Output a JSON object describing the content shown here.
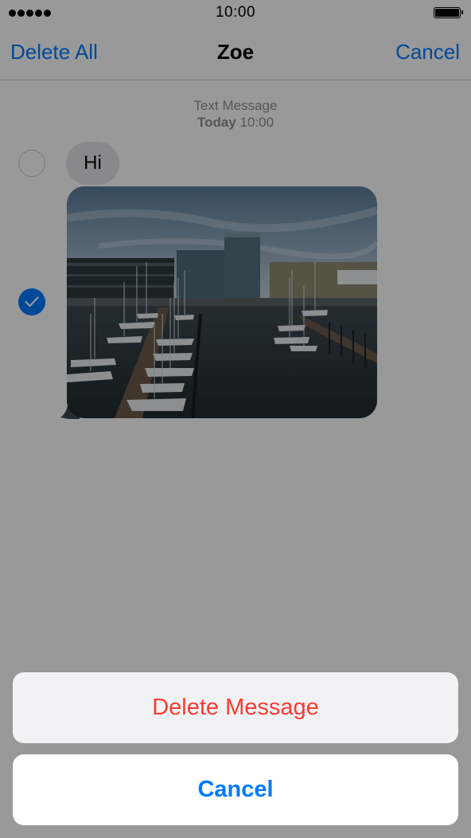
{
  "status_bar": {
    "time": "10:00",
    "signal_icon": "signal-dots-icon",
    "battery_icon": "battery-icon"
  },
  "nav": {
    "left_label": "Delete All",
    "title": "Zoe",
    "right_label": "Cancel"
  },
  "conversation": {
    "header_type": "Text Message",
    "date_day": "Today",
    "date_time": "10:00",
    "messages": [
      {
        "kind": "text",
        "text": "Hi",
        "selected": false
      },
      {
        "kind": "photo",
        "subject": "harbor-marina-photo",
        "selected": true
      }
    ]
  },
  "action_sheet": {
    "delete_label": "Delete Message",
    "cancel_label": "Cancel"
  },
  "colors": {
    "accent": "#007aff",
    "destructive": "#ff3b30",
    "incoming_bubble": "#e5e5ea",
    "dim_overlay": "rgba(0,0,0,0.40)"
  }
}
